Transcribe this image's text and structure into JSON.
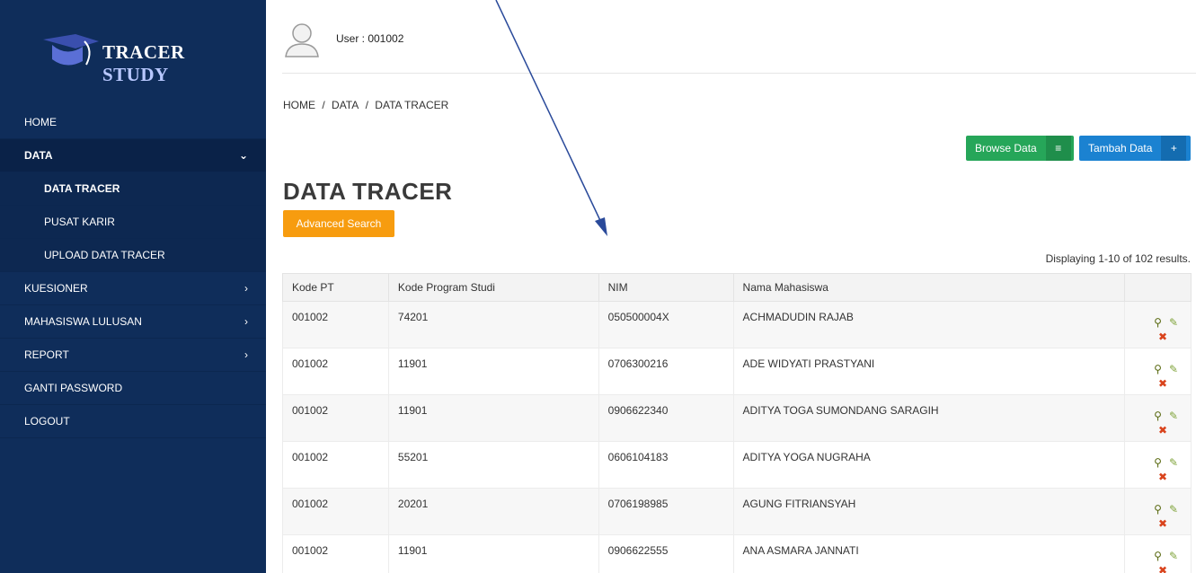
{
  "sidebar": {
    "logo_text_1": "TRACER",
    "logo_text_2": " STUDY",
    "items": [
      {
        "label": "HOME"
      },
      {
        "label": "DATA"
      },
      {
        "label": "DATA TRACER"
      },
      {
        "label": "PUSAT KARIR"
      },
      {
        "label": "UPLOAD DATA TRACER"
      },
      {
        "label": "KUESIONER"
      },
      {
        "label": "MAHASISWA LULUSAN"
      },
      {
        "label": "REPORT"
      },
      {
        "label": "GANTI PASSWORD"
      },
      {
        "label": "LOGOUT"
      }
    ]
  },
  "header": {
    "user_label": "User : 001002"
  },
  "breadcrumb": [
    "HOME",
    "/",
    "DATA",
    "/",
    "DATA TRACER"
  ],
  "toolbar": {
    "browse_label": "Browse Data",
    "add_label": "Tambah Data"
  },
  "page": {
    "title": "DATA TRACER",
    "advanced_search": "Advanced Search",
    "summary": "Displaying 1-10 of 102 results."
  },
  "table": {
    "headers": [
      "Kode PT",
      "Kode Program Studi",
      "NIM",
      "Nama Mahasiswa"
    ],
    "rows": [
      [
        "001002",
        "74201",
        "050500004X",
        "ACHMADUDIN RAJAB"
      ],
      [
        "001002",
        "11901",
        "0706300216",
        "ADE WIDYATI PRASTYANI"
      ],
      [
        "001002",
        "11901",
        "0906622340",
        "ADITYA TOGA SUMONDANG SARAGIH"
      ],
      [
        "001002",
        "55201",
        "0606104183",
        "ADITYA YOGA NUGRAHA"
      ],
      [
        "001002",
        "20201",
        "0706198985",
        "AGUNG FITRIANSYAH"
      ],
      [
        "001002",
        "11901",
        "0906622555",
        "ANA ASMARA JANNATI"
      ]
    ]
  },
  "colors": {
    "sidebar": "#0f2d5a",
    "browse": "#26a659",
    "add": "#1b82d1",
    "advanced": "#f79c0f"
  }
}
